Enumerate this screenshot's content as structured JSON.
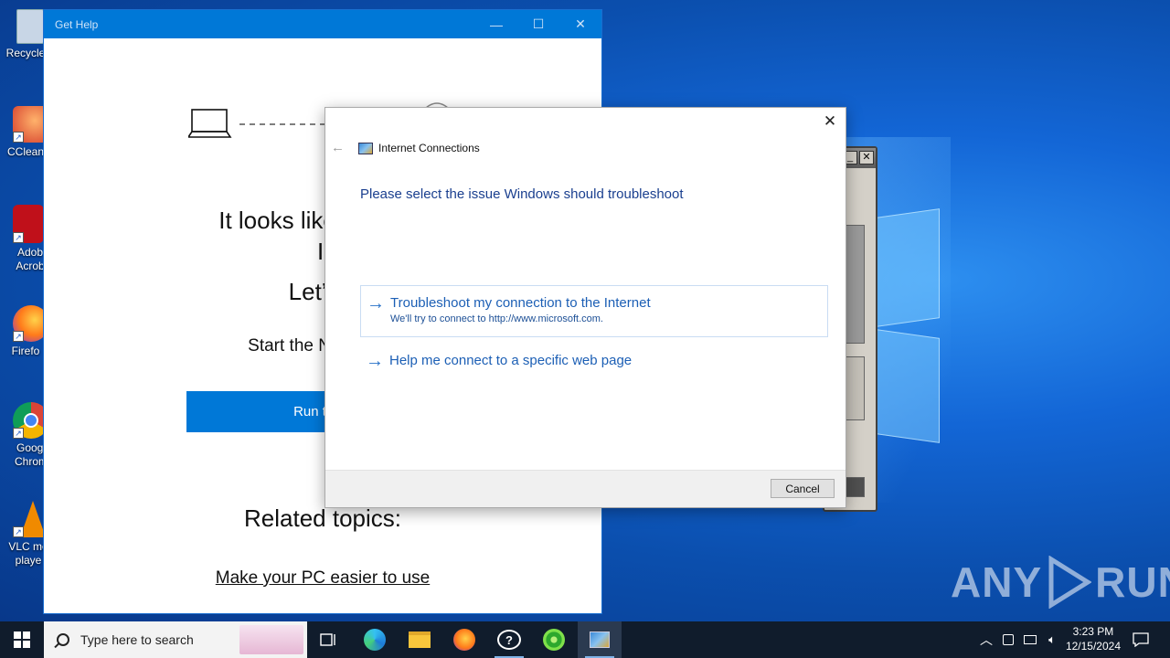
{
  "desktop": {
    "icons": [
      {
        "label": "Recycle",
        "color": "#c8d6e6"
      },
      {
        "label": "CClean",
        "color": "#d43a2a"
      },
      {
        "label": "Adob Acrob",
        "color": "#c0101a"
      },
      {
        "label": "Firefo",
        "color": "#ff7a1a"
      },
      {
        "label": "Googl Chrom",
        "color": "#2f9c4a"
      },
      {
        "label": "VLC me playe",
        "color": "#f08a00"
      }
    ],
    "watermark": {
      "left": "ANY",
      "right": "RUN"
    }
  },
  "get_help": {
    "title": "Get Help",
    "controls": {
      "minimize": "—",
      "maximize": "☐",
      "close": "✕"
    },
    "heading_line1": "It looks like you're n",
    "heading_line2": "Inter",
    "heading_line3": "Let’s fi",
    "subtext": "Start the Network tr",
    "run_button": "Run troub",
    "related_title": "Related topics:",
    "related_link": "Make your PC easier to use"
  },
  "dialog": {
    "close": "✕",
    "back": "←",
    "title": "Internet Connections",
    "instruction": "Please select the issue Windows should troubleshoot",
    "options": [
      {
        "title": "Troubleshoot my connection to the Internet",
        "desc": "We'll try to connect to http://www.microsoft.com."
      },
      {
        "title": "Help me connect to a specific web page",
        "desc": ""
      }
    ],
    "cancel": "Cancel"
  },
  "taskbar": {
    "start_icon": "windows-start-icon",
    "search_placeholder": "Type here to search",
    "apps": [
      "task-view-icon",
      "edge-icon",
      "file-explorer-icon",
      "firefox-icon",
      "chat-help-icon",
      "green-app-icon",
      "internet-connections-icon"
    ],
    "clock_time": "3:23 PM",
    "clock_date": "12/15/2024",
    "tray_chevron": "^"
  }
}
